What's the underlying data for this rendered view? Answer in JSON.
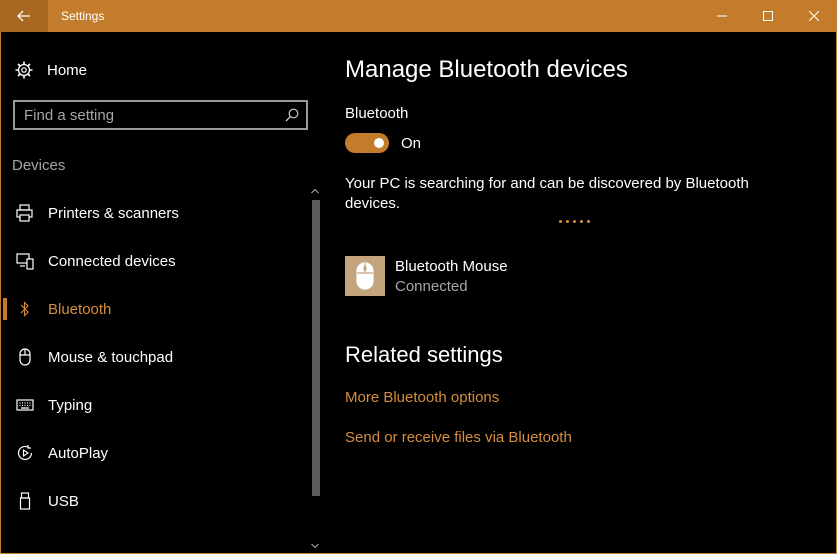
{
  "window": {
    "title": "Settings"
  },
  "sidebar": {
    "home_label": "Home",
    "search": {
      "placeholder": "Find a setting"
    },
    "section_label": "Devices",
    "items": [
      {
        "label": "Printers & scanners",
        "icon": "printer-icon"
      },
      {
        "label": "Connected devices",
        "icon": "devices-icon"
      },
      {
        "label": "Bluetooth",
        "icon": "bluetooth-icon",
        "active": true
      },
      {
        "label": "Mouse & touchpad",
        "icon": "mouse-icon"
      },
      {
        "label": "Typing",
        "icon": "keyboard-icon"
      },
      {
        "label": "AutoPlay",
        "icon": "autoplay-icon"
      },
      {
        "label": "USB",
        "icon": "usb-icon"
      }
    ]
  },
  "main": {
    "title": "Manage Bluetooth devices",
    "bluetooth_label": "Bluetooth",
    "toggle_state": "On",
    "description": "Your PC is searching for and can be discovered by Bluetooth devices.",
    "device": {
      "name": "Bluetooth Mouse",
      "status": "Connected",
      "icon": "mouse-icon"
    },
    "related_title": "Related settings",
    "links": [
      "More Bluetooth options",
      "Send or receive files via Bluetooth"
    ]
  },
  "colors": {
    "accent": "#c27c2b",
    "accent_text": "#d68d3d",
    "background": "#000000",
    "muted_text": "#a6a6a6"
  }
}
